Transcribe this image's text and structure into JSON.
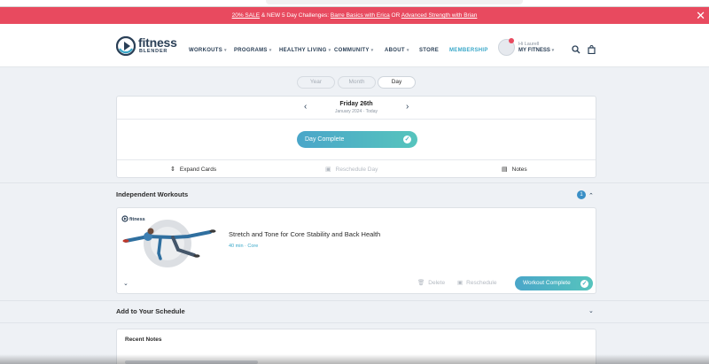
{
  "promo": {
    "sale_link": "20% SALE",
    "middle_text": " & NEW 5 Day Challenges: ",
    "challenge_1": "Barre Basics with Erica",
    "or_text": " OR ",
    "challenge_2": "Advanced Strength with Brian",
    "close": "✕"
  },
  "header": {
    "logo_word": "fitness",
    "logo_sub": "BLENDER",
    "menu": [
      "WORKOUTS",
      "PROGRAMS",
      "HEALTHY LIVING",
      "COMMUNITY",
      "ABOUT",
      "STORE",
      "MEMBERSHIP"
    ],
    "caret": "▾",
    "user_greeting": "Hi Laurell",
    "user_menu": "MY FITNESS",
    "search_icon": "search-icon",
    "cart_icon": "bag-icon"
  },
  "view_tabs": [
    "Year",
    "Month",
    "Day"
  ],
  "active_tab": "Day",
  "day": {
    "prev": "‹",
    "next": "›",
    "date": "Friday 26th",
    "subdate": "January 2024 · Today",
    "complete_label": "Day Complete",
    "check": "✓",
    "actions": {
      "expand": "Expand Cards",
      "reschedule": "Reschedule Day",
      "notes": "Notes"
    }
  },
  "independent": {
    "title": "Independent Workouts",
    "count": "1",
    "collapse": "⌃"
  },
  "workout": {
    "brand": "fitness",
    "title": "Stretch and Tone for Core Stability and Back Health",
    "meta": "40 min · Core",
    "expand": "⌄",
    "delete": "Delete",
    "reschedule": "Reschedule",
    "complete": "Workout Complete",
    "check": "✓"
  },
  "schedule": {
    "title": "Add to Your Schedule",
    "expand": "⌄"
  },
  "notes": {
    "title": "Recent Notes"
  },
  "colors": {
    "promo": "#e84a5f",
    "accent_gradient_start": "#4aa6c9",
    "accent_gradient_end": "#56c4bd",
    "navy": "#2a3f56",
    "link": "#3aa8c9"
  }
}
